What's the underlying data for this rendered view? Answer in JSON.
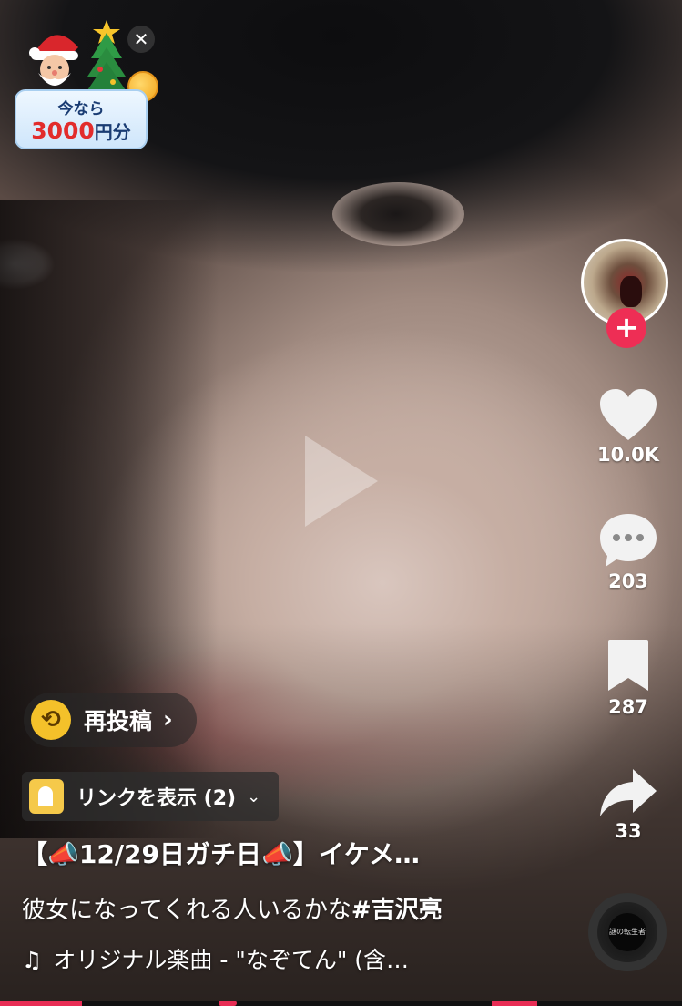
{
  "promo": {
    "line1": "今なら",
    "amount": "3000",
    "unit": "円分",
    "close_glyph": "✕"
  },
  "play_icon": "play-icon",
  "rail": {
    "follow_glyph": "+",
    "likes": "10.0K",
    "comments": "203",
    "saves": "287",
    "shares": "33",
    "disc_text": "謎の転生者"
  },
  "repost": {
    "label": "再投稿",
    "chevron": "›"
  },
  "link_chip": {
    "label": "リンクを表示 (2)",
    "chevron": "⌄"
  },
  "caption": {
    "title": "【📣12/29日ガチ日📣】イケメ…",
    "desc_text": "彼女になってくれる人いるかな",
    "desc_tag": "#吉沢亮",
    "music": "オリジナル楽曲 - \"なぞてん\" (含…",
    "music_note": "♫"
  },
  "colors": {
    "follow_red": "#ee2e55",
    "repost_yellow": "#f4c12a",
    "promo_red": "#e22c2c"
  }
}
